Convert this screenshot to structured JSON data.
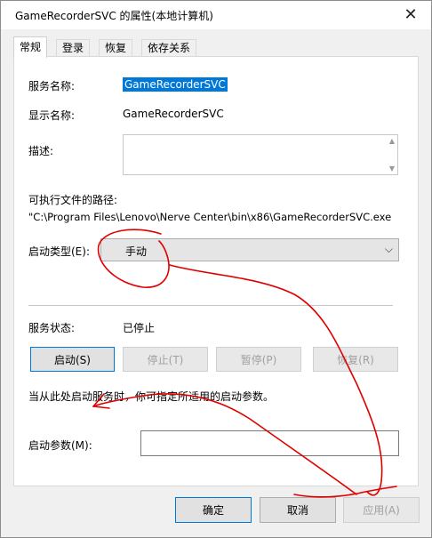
{
  "window": {
    "title": "GameRecorderSVC 的属性(本地计算机)",
    "close_glyph": "✕"
  },
  "tabs": [
    {
      "label": "常规"
    },
    {
      "label": "登录"
    },
    {
      "label": "恢复"
    },
    {
      "label": "依存关系"
    }
  ],
  "general": {
    "service_name_label": "服务名称:",
    "service_name_value": "GameRecorderSVC",
    "display_name_label": "显示名称:",
    "display_name_value": "GameRecorderSVC",
    "description_label": "描述:",
    "exe_path_label": "可执行文件的路径:",
    "exe_path_value": "\"C:\\Program Files\\Lenovo\\Nerve Center\\bin\\x86\\GameRecorderSVC.exe",
    "startup_type_label": "启动类型(E):",
    "startup_type_value": "手动",
    "service_status_label": "服务状态:",
    "service_status_value": "已停止",
    "start_button": "启动(S)",
    "stop_button": "停止(T)",
    "pause_button": "暂停(P)",
    "resume_button": "恢复(R)",
    "hint_text": "当从此处启动服务时，你可指定所适用的启动参数。",
    "start_params_label": "启动参数(M):",
    "start_params_value": ""
  },
  "footer": {
    "ok_button": "确定",
    "cancel_button": "取消",
    "apply_button": "应用(A)"
  },
  "icons": {
    "scroll_up": "▲",
    "scroll_down": "▼",
    "dropdown": "⌵"
  },
  "colors": {
    "selection": "#0078d7",
    "annotation": "#e00000"
  }
}
